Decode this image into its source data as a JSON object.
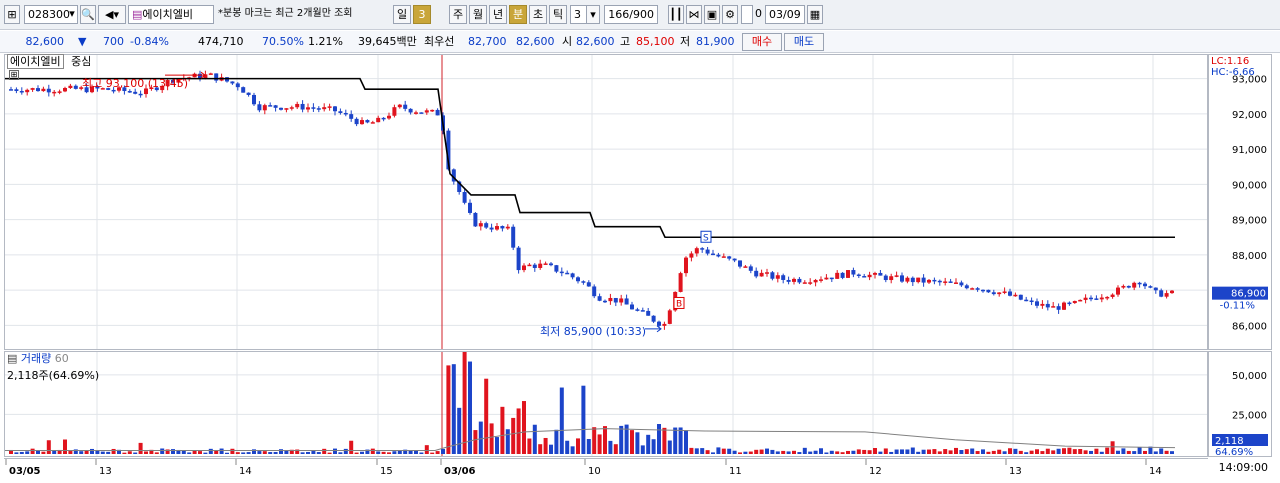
{
  "toolbar": {
    "code": "028300",
    "name": "에이치엘비",
    "notice": "*분봉 마크는 최근 2개월만 조회",
    "periods": [
      "일",
      "3",
      "주",
      "월",
      "년",
      "분",
      "초",
      "틱"
    ],
    "interval": "3",
    "count": "166/900",
    "date": "03/09",
    "zero": "0"
  },
  "quote": {
    "price": "82,600",
    "change_arrow": "▼",
    "change": "700",
    "change_pct": "-0.84%",
    "volume": "474,710",
    "vol_ratio": "70.50%",
    "turnover": "1.21%",
    "amount": "39,645백만",
    "best_label": "최우선",
    "best_ask": "82,700",
    "best_bid": "82,600",
    "open_label": "시",
    "open": "82,600",
    "high_label": "고",
    "high": "85,100",
    "low_label": "저",
    "low": "81,900",
    "buy_label": "매수",
    "sell_label": "매도"
  },
  "legend": {
    "name": "에이치엘비",
    "center": "중심",
    "lc": "LC:1.16",
    "hc": "HC:-6.66"
  },
  "annotations": {
    "high": "최고 93,100 (13:45)",
    "low": "최저 85,900 (10:33)",
    "buy": "B",
    "sell": "S"
  },
  "price_axis": {
    "ticks": [
      "93,000",
      "92,000",
      "91,000",
      "90,000",
      "89,000",
      "88,000",
      "87,000",
      "86,000"
    ],
    "current": "86,900",
    "current_pct": "-0.11%"
  },
  "volume_panel": {
    "label": "거래량",
    "period": "60",
    "info": "2,118주(64.69%)",
    "ticks": [
      "50,000",
      "25,000"
    ],
    "current": "2,118",
    "current_pct": "64.69%"
  },
  "time_axis": [
    "03/05",
    "13",
    "14",
    "15",
    "03/06",
    "10",
    "11",
    "12",
    "13",
    "14"
  ],
  "clock": "14:09:00",
  "colors": {
    "up": "#e0141e",
    "down": "#1c44c9",
    "line": "#000000",
    "ma": "#808080"
  },
  "chart_data": {
    "type": "candlestick",
    "dates": [
      "03/05",
      "03/06"
    ],
    "price_range": [
      85500,
      93500
    ],
    "volume_range": [
      0,
      60000
    ],
    "price_ticks": [
      93000,
      92000,
      91000,
      90000,
      89000,
      88000,
      87000,
      86000
    ],
    "volume_ticks": [
      50000,
      25000
    ],
    "high": 93100,
    "low": 85900,
    "last": 86900
  }
}
